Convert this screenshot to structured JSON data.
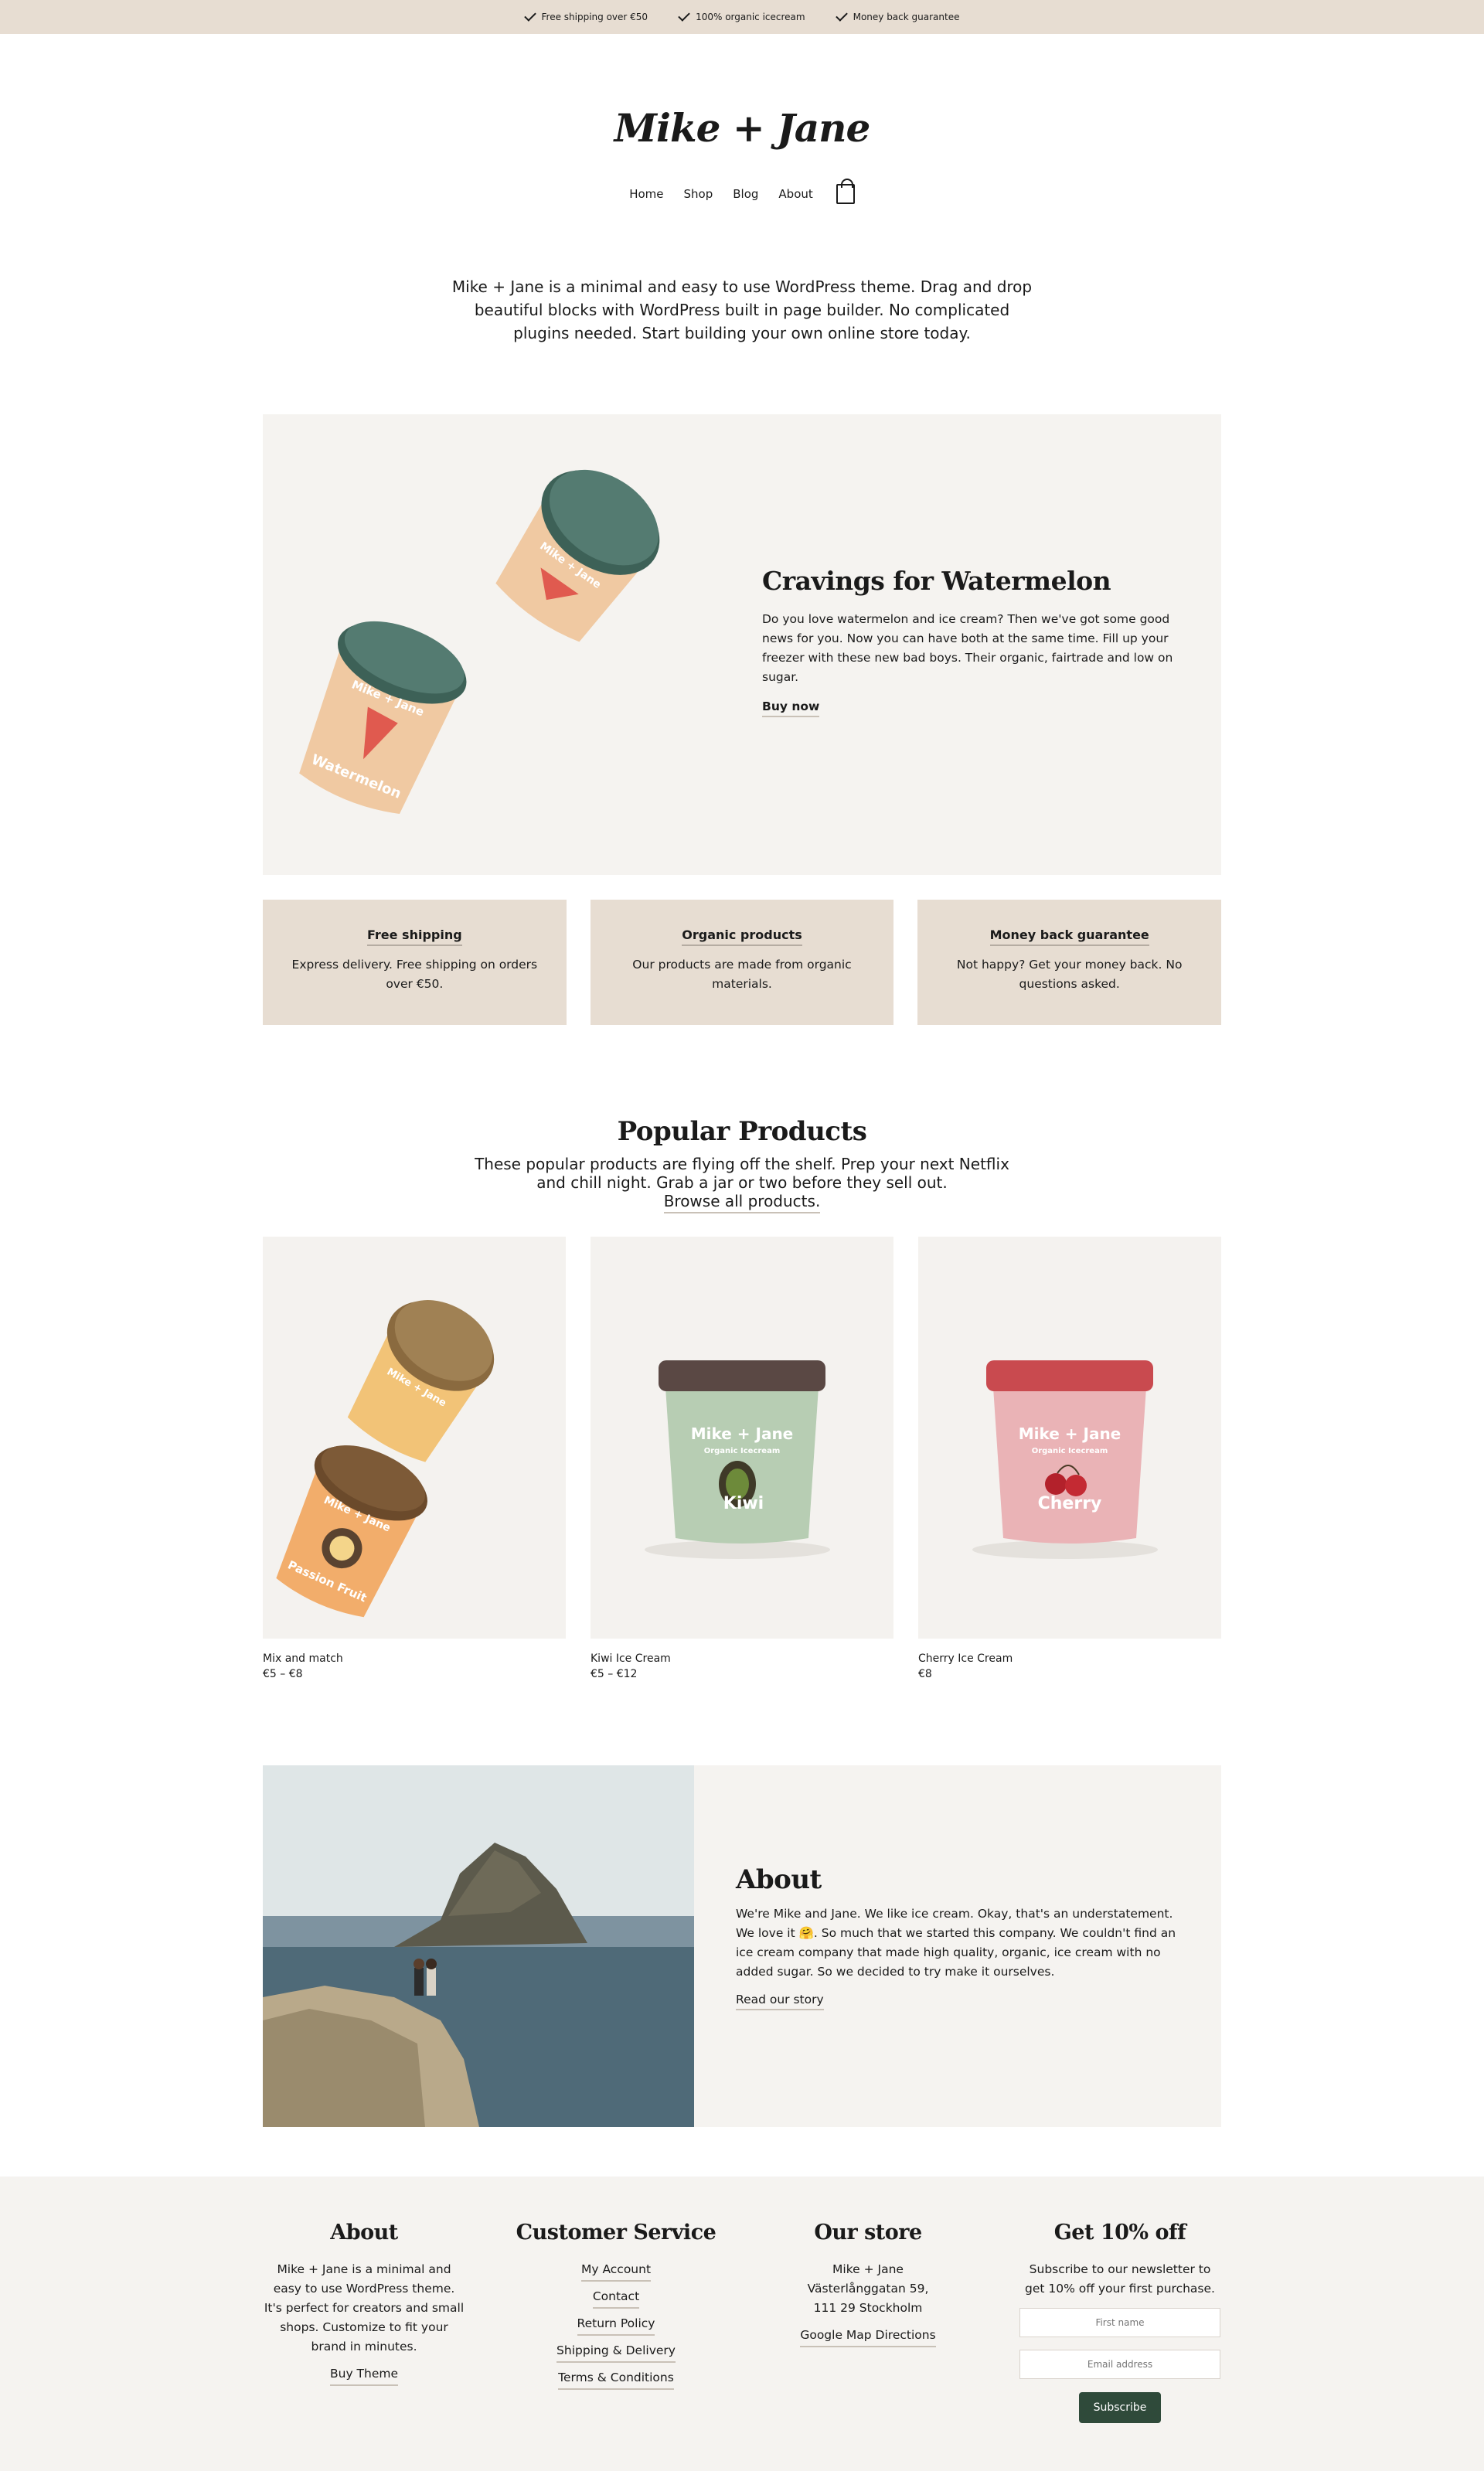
{
  "topbar": {
    "usps": [
      "Free shipping over €50",
      "100% organic icecream",
      "Money back guarantee"
    ]
  },
  "header": {
    "logo": "Mike + Jane",
    "nav": [
      "Home",
      "Shop",
      "Blog",
      "About"
    ]
  },
  "intro": "Mike + Jane is a minimal and easy to use WordPress theme. Drag and drop beautiful blocks with WordPress built in page builder. No complicated plugins needed. Start building your own online store today.",
  "hero": {
    "title": "Cravings for Watermelon",
    "text": "Do you love watermelon and ice cream? Then we've got some good news for you. Now you can have both at the same time. Fill up your freezer with these new bad boys. Their organic, fairtrade and low on sugar.",
    "cta": "Buy now",
    "tub_labels": [
      "Mike + Jane",
      "Watermelon"
    ]
  },
  "features": [
    {
      "title": "Free shipping",
      "text": "Express delivery. Free shipping on orders over €50."
    },
    {
      "title": "Organic products",
      "text": "Our products are made from organic materials."
    },
    {
      "title": "Money back guarantee",
      "text": "Not happy? Get your money back. No questions asked."
    }
  ],
  "popular": {
    "title": "Popular Products",
    "text": "These popular products are flying off the shelf. Prep your next Netflix and chill night. Grab a jar or two before they sell out.",
    "link": "Browse all products.",
    "products": [
      {
        "name": "Mix and match",
        "price": "€5 – €8",
        "tub_labels": [
          "Mike + Jane",
          "Passion Fruit"
        ]
      },
      {
        "name": "Kiwi Ice Cream",
        "price": "€5 – €12",
        "tub_labels": [
          "Mike + Jane",
          "Organic Icecream",
          "Kiwi"
        ]
      },
      {
        "name": "Cherry Ice Cream",
        "price": "€8",
        "tub_labels": [
          "Mike + Jane",
          "Organic Icecream",
          "Cherry"
        ]
      }
    ]
  },
  "about": {
    "title": "About",
    "text": "We're Mike and Jane. We like ice cream. Okay, that's an understatement. We love it 🤗. So much that we started this company. We couldn't find an ice cream company that made high quality, organic, ice cream with no added sugar. So we decided to try make it ourselves.",
    "link": "Read our story"
  },
  "footer": {
    "about": {
      "title": "About",
      "text": "Mike + Jane is a minimal and easy to use WordPress theme. It's perfect for creators and small shops. Customize to fit your brand in minutes.",
      "link": "Buy Theme"
    },
    "service": {
      "title": "Customer Service",
      "links": [
        "My Account",
        "Contact",
        "Return Policy",
        "Shipping & Delivery",
        "Terms & Conditions"
      ]
    },
    "store": {
      "title": "Our store",
      "lines": [
        "Mike + Jane",
        "Västerlånggatan 59,",
        "111 29 Stockholm"
      ],
      "link": "Google Map Directions"
    },
    "newsletter": {
      "title": "Get 10% off",
      "text": "Subscribe to our newsletter to get 10% off your first purchase.",
      "first_name_placeholder": "First name",
      "email_placeholder": "Email address",
      "button": "Subscribe"
    }
  },
  "colors": {
    "topbar_bg": "#e7ddd2",
    "panel_bg": "#f5f3f0",
    "feature_bg": "#e7ddd2",
    "button_bg": "#2f4a3a"
  }
}
